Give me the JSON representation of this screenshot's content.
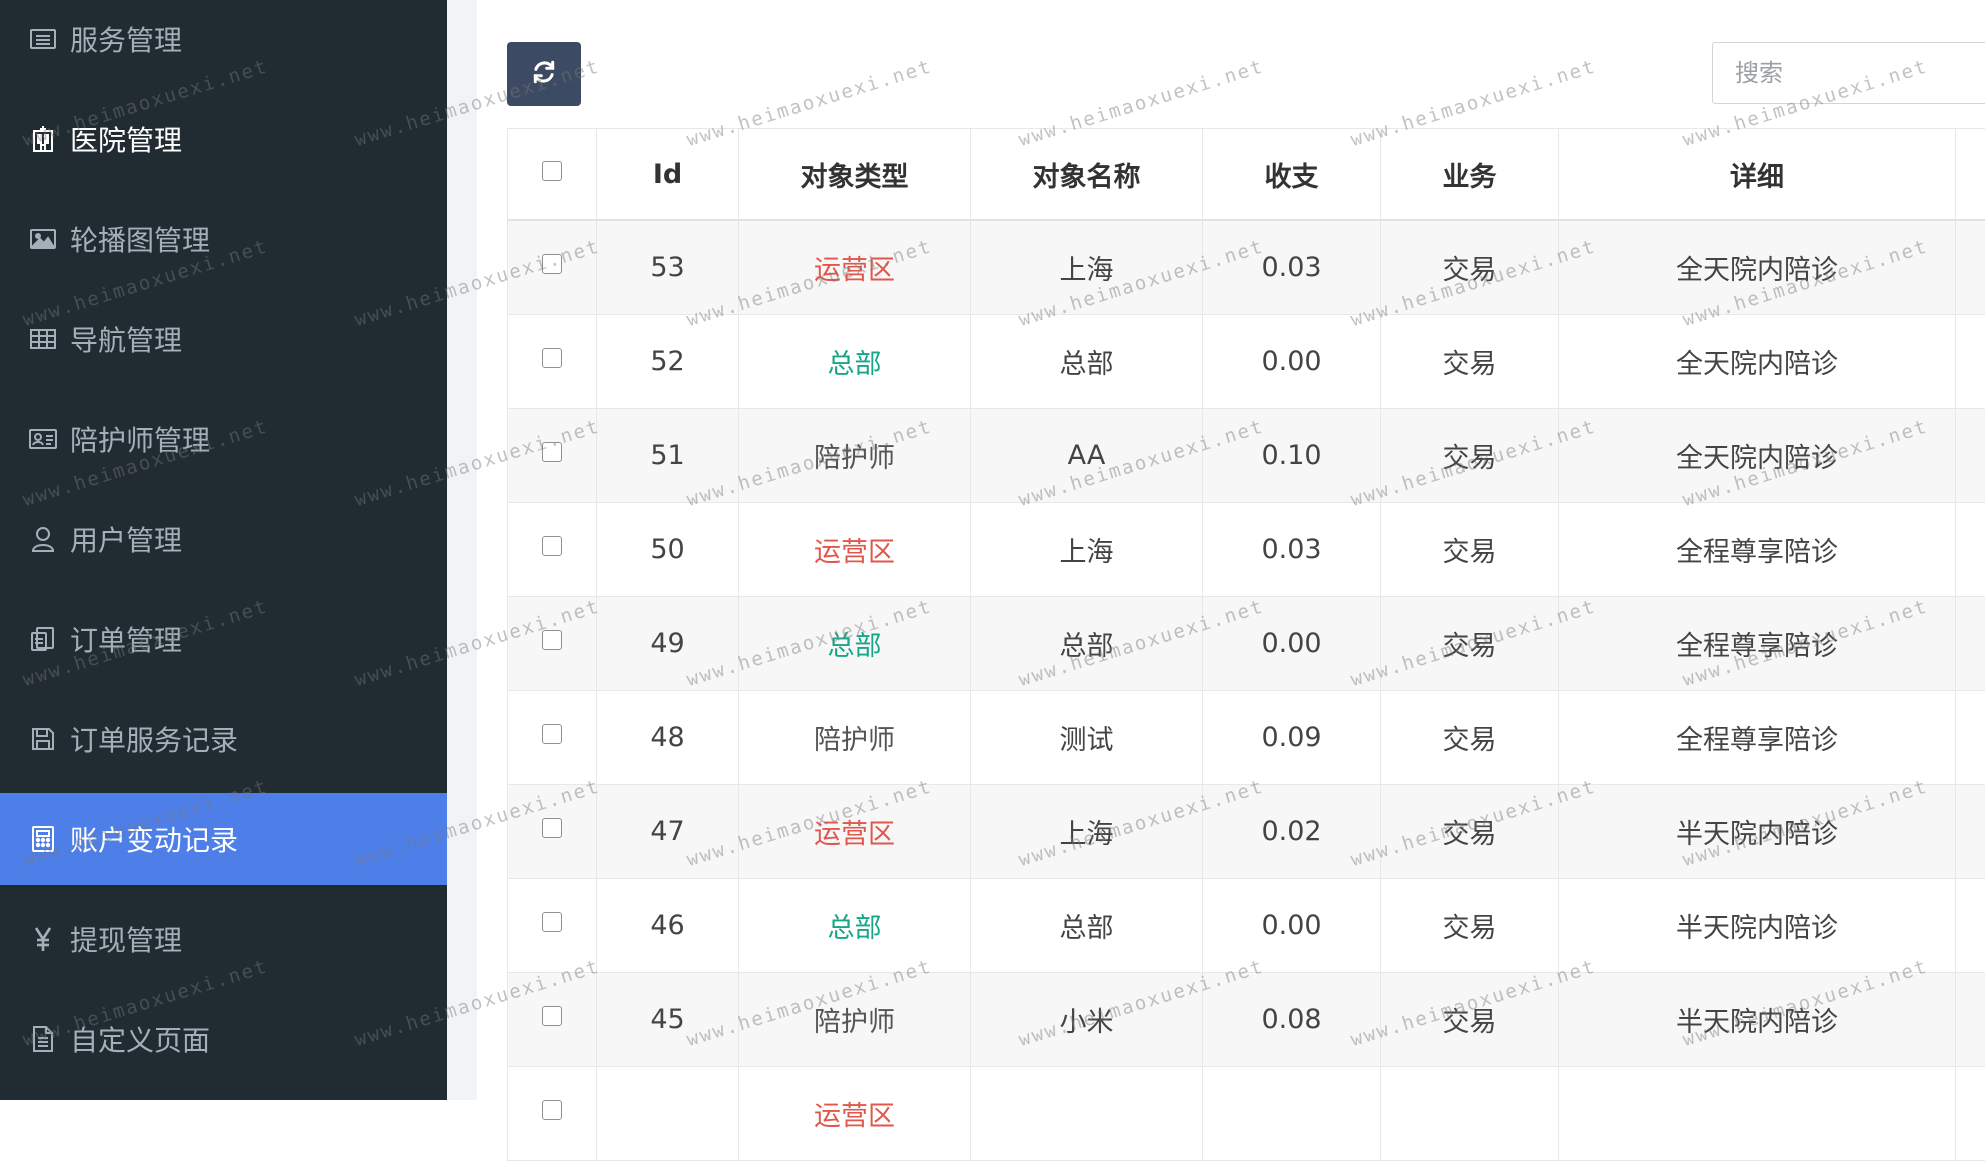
{
  "sidebar": {
    "items": [
      {
        "label": "服务管理",
        "icon": "list-icon",
        "state": "normal"
      },
      {
        "label": "医院管理",
        "icon": "hospital-icon",
        "state": "highlight"
      },
      {
        "label": "轮播图管理",
        "icon": "image-icon",
        "state": "normal"
      },
      {
        "label": "导航管理",
        "icon": "table-icon",
        "state": "normal"
      },
      {
        "label": "陪护师管理",
        "icon": "id-card-icon",
        "state": "normal"
      },
      {
        "label": "用户管理",
        "icon": "user-icon",
        "state": "normal"
      },
      {
        "label": "订单管理",
        "icon": "clipboard-icon",
        "state": "normal"
      },
      {
        "label": "订单服务记录",
        "icon": "save-icon",
        "state": "normal"
      },
      {
        "label": "账户变动记录",
        "icon": "calculator-icon",
        "state": "active"
      },
      {
        "label": "提现管理",
        "icon": "yen-icon",
        "state": "normal"
      },
      {
        "label": "自定义页面",
        "icon": "file-icon",
        "state": "normal"
      }
    ]
  },
  "toolbar": {
    "refresh_icon": "refresh-icon",
    "search_placeholder": "搜索"
  },
  "table": {
    "headers": [
      "Id",
      "对象类型",
      "对象名称",
      "收支",
      "业务",
      "详细"
    ],
    "rows": [
      {
        "id": "53",
        "type": "运营区",
        "name": "上海",
        "amount": "0.03",
        "business": "交易",
        "detail": "全天院内陪诊"
      },
      {
        "id": "52",
        "type": "总部",
        "name": "总部",
        "amount": "0.00",
        "business": "交易",
        "detail": "全天院内陪诊"
      },
      {
        "id": "51",
        "type": "陪护师",
        "name": "AA",
        "amount": "0.10",
        "business": "交易",
        "detail": "全天院内陪诊"
      },
      {
        "id": "50",
        "type": "运营区",
        "name": "上海",
        "amount": "0.03",
        "business": "交易",
        "detail": "全程尊享陪诊"
      },
      {
        "id": "49",
        "type": "总部",
        "name": "总部",
        "amount": "0.00",
        "business": "交易",
        "detail": "全程尊享陪诊"
      },
      {
        "id": "48",
        "type": "陪护师",
        "name": "测试",
        "amount": "0.09",
        "business": "交易",
        "detail": "全程尊享陪诊"
      },
      {
        "id": "47",
        "type": "运营区",
        "name": "上海",
        "amount": "0.02",
        "business": "交易",
        "detail": "半天院内陪诊"
      },
      {
        "id": "46",
        "type": "总部",
        "name": "总部",
        "amount": "0.00",
        "business": "交易",
        "detail": "半天院内陪诊"
      },
      {
        "id": "45",
        "type": "陪护师",
        "name": "小米",
        "amount": "0.08",
        "business": "交易",
        "detail": "半天院内陪诊"
      },
      {
        "id": "",
        "type": "运营区",
        "name": "",
        "amount": "",
        "business": "",
        "detail": ""
      }
    ]
  },
  "type_colors": {
    "运营区": "#e2564b",
    "总部": "#18a689",
    "陪护师": "#555555"
  },
  "watermark": "www.heimaoxuexi.net"
}
